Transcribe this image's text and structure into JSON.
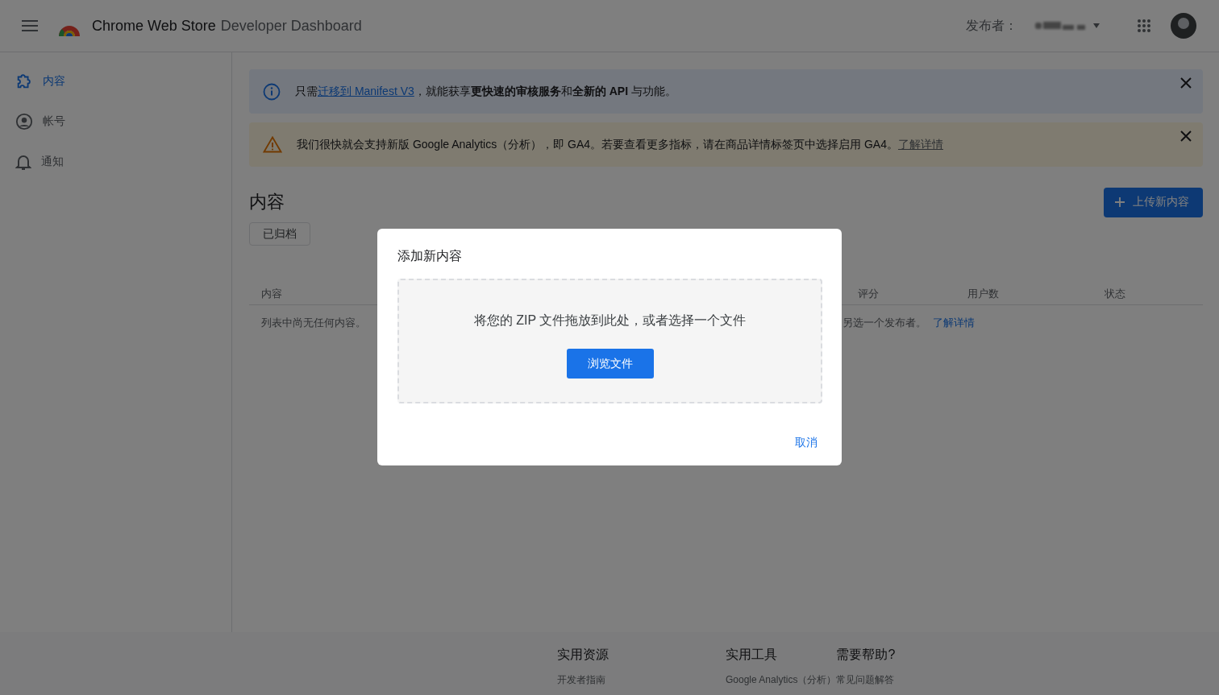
{
  "header": {
    "title": "Chrome Web Store",
    "subtitle": "Developer Dashboard",
    "publisher_label": "发布者："
  },
  "sidebar": {
    "items": [
      {
        "label": "内容",
        "kind": "puzzle",
        "selected": true
      },
      {
        "label": "帐号",
        "kind": "account",
        "selected": false
      },
      {
        "label": "通知",
        "kind": "bell",
        "selected": false
      }
    ]
  },
  "banners": [
    {
      "kind": "info",
      "text_before": "只需",
      "link": "迁移到 Manifest V3",
      "text_after": "，就能获享**更快速的审核服务**和**全新的 API** 与功能。"
    },
    {
      "kind": "warning",
      "text_before": "我们很快就会支持新版 Google Analytics（分析），即 GA4。若要查看更多指标，请在商品详情标签页中选择启用 GA4。",
      "link": "了解详情"
    }
  ],
  "content": {
    "title": "内容",
    "upload_button": "上传新内容",
    "archived_button": "已归档",
    "columns": [
      "内容",
      "评分",
      "用户数",
      "状态"
    ],
    "empty_text": "列表中尚无任何内容。",
    "empty_text_right": "另选一个发布者。",
    "empty_link": "了解详情"
  },
  "dialog": {
    "title": "添加新内容",
    "drop_text": "将您的 ZIP 文件拖放到此处，或者选择一个文件",
    "browse_button": "浏览文件",
    "cancel_button": "取消"
  },
  "footer": {
    "columns": [
      {
        "heading": "实用资源",
        "links": [
          "开发者指南"
        ]
      },
      {
        "heading": "实用工具",
        "links": [
          "Google Analytics（分析）"
        ]
      },
      {
        "heading": "需要帮助?",
        "links": [
          "常见问题解答"
        ]
      }
    ]
  }
}
